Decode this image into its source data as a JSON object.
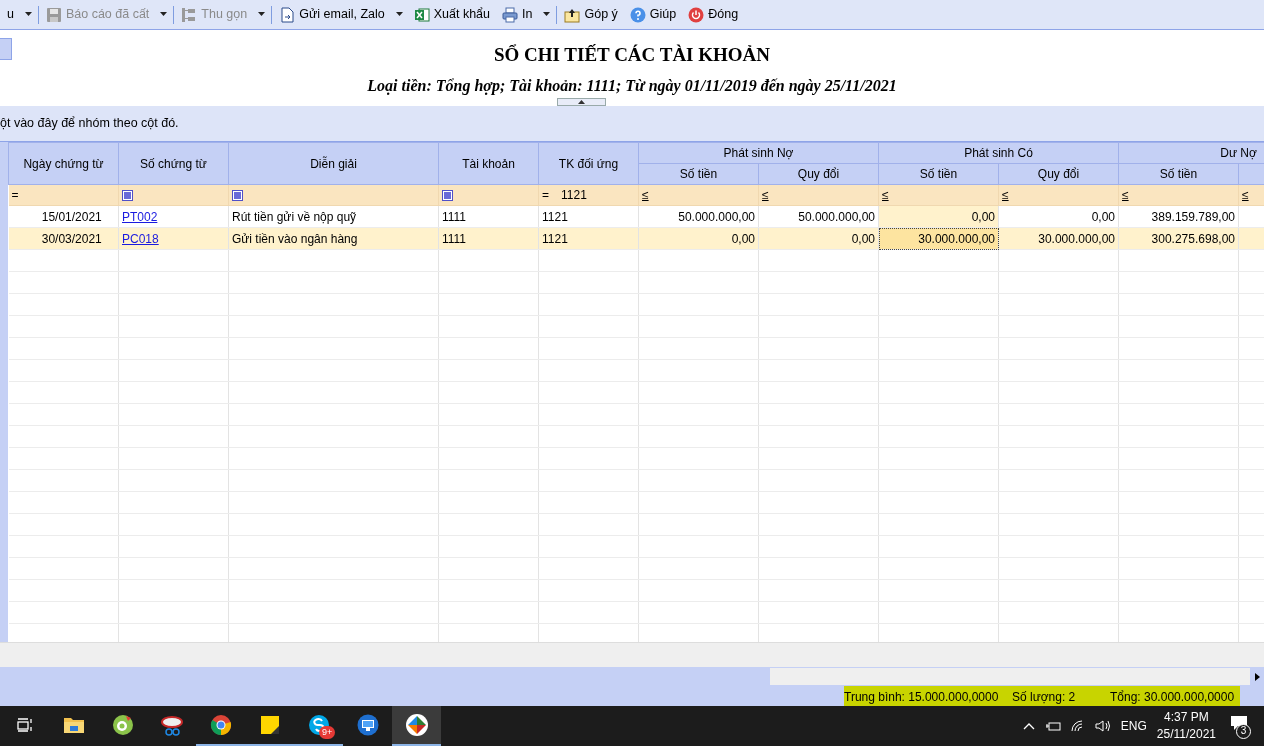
{
  "toolbar": {
    "groups": [
      [
        {
          "label": "u",
          "disabled": false,
          "dropdown": true
        }
      ],
      [
        {
          "label": "Báo cáo đã cất",
          "disabled": true,
          "dropdown": true
        }
      ],
      [
        {
          "label": "Thu gọn",
          "disabled": true,
          "dropdown": true
        }
      ],
      [
        {
          "label": "Gửi email, Zalo",
          "disabled": false,
          "dropdown": true
        },
        {
          "label": "Xuất khẩu",
          "disabled": false,
          "dropdown": false
        },
        {
          "label": "In",
          "disabled": false,
          "dropdown": true
        }
      ],
      [
        {
          "label": "Góp ý",
          "disabled": false,
          "dropdown": false
        },
        {
          "label": "Giúp",
          "disabled": false,
          "dropdown": false
        },
        {
          "label": "Đóng",
          "disabled": false,
          "dropdown": false
        }
      ]
    ]
  },
  "report": {
    "title": "SỔ CHI TIẾT CÁC TÀI KHOẢN",
    "subtitle": "Loại tiền: Tổng hợp; Tài khoản: 1111; Từ ngày 01/11/2019 đến ngày 25/11/2021"
  },
  "group_panel": {
    "hint": "ột vào đây để nhóm theo cột đó."
  },
  "table": {
    "columns": [
      {
        "label": "Ngày chứng từ",
        "kind": "date",
        "selected": false
      },
      {
        "label": "Số chứng từ",
        "kind": "link",
        "selected": false
      },
      {
        "label": "Diễn giải",
        "kind": "text",
        "selected": false
      },
      {
        "label": "Tài khoản",
        "kind": "text",
        "selected": false
      },
      {
        "label": "TK đối ứng",
        "kind": "text",
        "selected": false
      }
    ],
    "column_groups": [
      {
        "label": "Phát sinh Nợ",
        "columns": [
          {
            "label": "Số tiền",
            "kind": "number",
            "selected": false
          },
          {
            "label": "Quy đổi",
            "kind": "number",
            "selected": false
          }
        ]
      },
      {
        "label": "Phát sinh Có",
        "columns": [
          {
            "label": "Số tiền",
            "kind": "number",
            "selected": true
          },
          {
            "label": "Quy đổi",
            "kind": "number",
            "selected": false
          }
        ]
      },
      {
        "label": "Dư Nợ",
        "columns": [
          {
            "label": "Số tiền",
            "kind": "number",
            "selected": false
          },
          {
            "kind": "number",
            "selected": false
          }
        ]
      }
    ],
    "filters": [
      {
        "kind": "operator",
        "operator": "="
      },
      {
        "kind": "checkbox",
        "checked": true
      },
      {
        "kind": "checkbox",
        "checked": true
      },
      {
        "kind": "checkbox",
        "checked": true
      },
      {
        "kind": "operator",
        "operator": "=",
        "value": "1121"
      },
      {
        "kind": "operator",
        "operator": "≤"
      },
      {
        "kind": "operator",
        "operator": "≤"
      },
      {
        "kind": "operator",
        "operator": "≤"
      },
      {
        "kind": "operator",
        "operator": "≤"
      },
      {
        "kind": "operator",
        "operator": "≤"
      },
      {
        "kind": "operator",
        "operator": "≤"
      }
    ],
    "rows": [
      {
        "selected": false,
        "cells": [
          "15/01/2021",
          "PT002",
          "Rút tiền gửi về nộp quỹ",
          "1111",
          "1121",
          "50.000.000,00",
          "50.000.000,00",
          "0,00",
          "0,00",
          "389.159.789,00"
        ]
      },
      {
        "selected": true,
        "cells": [
          "30/03/2021",
          "PC018",
          "Gửi tiền vào ngân hàng",
          "1111",
          "1121",
          "0,00",
          "0,00",
          "30.000.000,00",
          "30.000.000,00",
          "300.275.698,00"
        ]
      }
    ]
  },
  "status_bar": {
    "items": [
      "Trung bình: 15.000.000,0000",
      "Số lượng: 2",
      "Tổng: 30.000.000,0000"
    ]
  },
  "taskbar": {
    "apps": [
      {
        "running": false,
        "active": false
      },
      {
        "running": false,
        "active": false
      },
      {
        "running": false,
        "active": false
      },
      {
        "running": true,
        "active": false
      },
      {
        "running": true,
        "active": false
      },
      {
        "running": true,
        "active": false,
        "badge": "9+"
      },
      {
        "running": false,
        "active": false
      },
      {
        "running": true,
        "active": true
      }
    ],
    "language": "ENG",
    "time": "4:37 PM",
    "date": "25/11/2021",
    "notifications": "3"
  }
}
